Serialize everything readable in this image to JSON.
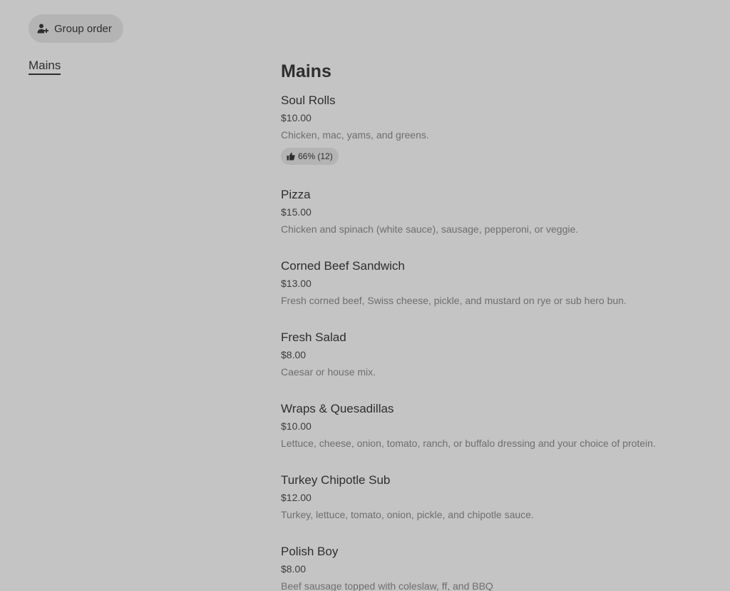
{
  "toolbar": {
    "group_order_label": "Group order",
    "group_order_icon": "add-person-icon"
  },
  "sidebar": {
    "items": [
      {
        "label": "Mains"
      }
    ]
  },
  "menu": {
    "section_title": "Mains",
    "items": [
      {
        "name": "Soul Rolls",
        "price": "$10.00",
        "description": "Chicken, mac, yams, and greens.",
        "rating": "66% (12)"
      },
      {
        "name": "Pizza",
        "price": "$15.00",
        "description": "Chicken and spinach (white sauce), sausage, pepperoni, or veggie."
      },
      {
        "name": "Corned Beef Sandwich",
        "price": "$13.00",
        "description": "Fresh corned beef, Swiss cheese, pickle, and mustard on rye or sub hero bun."
      },
      {
        "name": "Fresh Salad",
        "price": "$8.00",
        "description": "Caesar or house mix."
      },
      {
        "name": "Wraps & Quesadillas",
        "price": "$10.00",
        "description": "Lettuce, cheese, onion, tomato, ranch, or buffalo dressing and your choice of protein."
      },
      {
        "name": "Turkey Chipotle Sub",
        "price": "$12.00",
        "description": "Turkey, lettuce, tomato, onion, pickle, and chipotle sauce."
      },
      {
        "name": "Polish Boy",
        "price": "$8.00",
        "description": "Beef sausage topped with coleslaw, ff, and BBQ"
      }
    ]
  }
}
